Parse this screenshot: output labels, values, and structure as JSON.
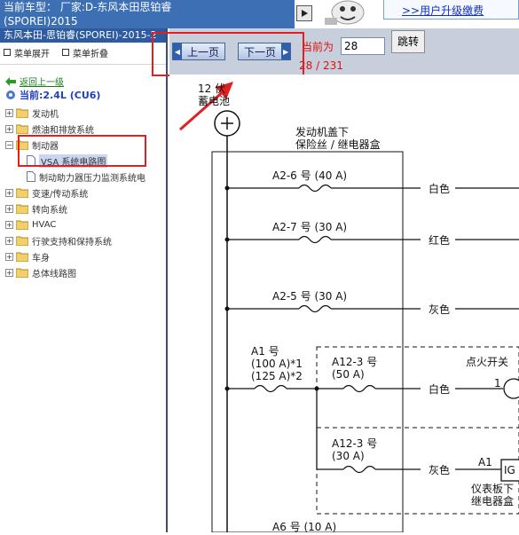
{
  "header": {
    "vehicle_line1": "当前车型：  厂家:D-东风本田思铂睿",
    "vehicle_line2": "(SPOREI)2015",
    "upgrade_link": ">>用户升级缴费"
  },
  "left_panel": {
    "title": "东风本田-思铂睿(SPOREI)-2015-2",
    "expand_all": "菜单展开",
    "collapse_all": "菜单折叠",
    "back_link": "返回上一级",
    "current": "当前:2.4L (CU6)",
    "tree": [
      {
        "label": "发动机",
        "expanded": false
      },
      {
        "label": "燃油和排放系统",
        "expanded": false
      },
      {
        "label": "制动器",
        "expanded": true,
        "children": [
          "VSA 系统电路图",
          "制动助力器压力监测系统电"
        ]
      },
      {
        "label": "变速/传动系统",
        "expanded": false
      },
      {
        "label": "转向系统",
        "expanded": false
      },
      {
        "label": "HVAC",
        "expanded": false
      },
      {
        "label": "行驶支持和保持系统",
        "expanded": false
      },
      {
        "label": "车身",
        "expanded": false
      },
      {
        "label": "总体线路图",
        "expanded": false
      }
    ]
  },
  "nav": {
    "prev_label": "上一页",
    "next_label": "下一页",
    "current_label": "当前为",
    "page_value": "28",
    "page_count": "28 / 231",
    "jump_label": "跳转"
  },
  "diagram": {
    "battery_label_1": "12 伏",
    "battery_label_2": "蓄电池",
    "fusebox_label_1": "发动机盖下",
    "fusebox_label_2": "保险丝 / 继电器盒",
    "fuses": [
      {
        "name": "A2-6 号 (40 A)",
        "wire": "白色"
      },
      {
        "name": "A2-7 号 (30 A)",
        "wire": "红色"
      },
      {
        "name": "A2-5 号 (30 A)",
        "wire": "灰色"
      }
    ],
    "a1_label_1": "A1 号",
    "a1_label_2": "(100 A)*1",
    "a1_label_3": "(125 A)*2",
    "a12_1_label_1": "A12-3 号",
    "a12_1_label_2": "(50 A)",
    "a12_1_wire": "白色",
    "ignition_label": "点火开关",
    "ignition_pin": "1",
    "a12_2_label_1": "A12-3 号",
    "a12_2_label_2": "(30 A)",
    "a12_2_wire": "灰色",
    "ig_connector": "A1",
    "ig_box": "IG",
    "dash_label_1": "仪表板下",
    "dash_label_2": "继电器盒",
    "bottom_fuse": "A6 号 (10 A)"
  }
}
